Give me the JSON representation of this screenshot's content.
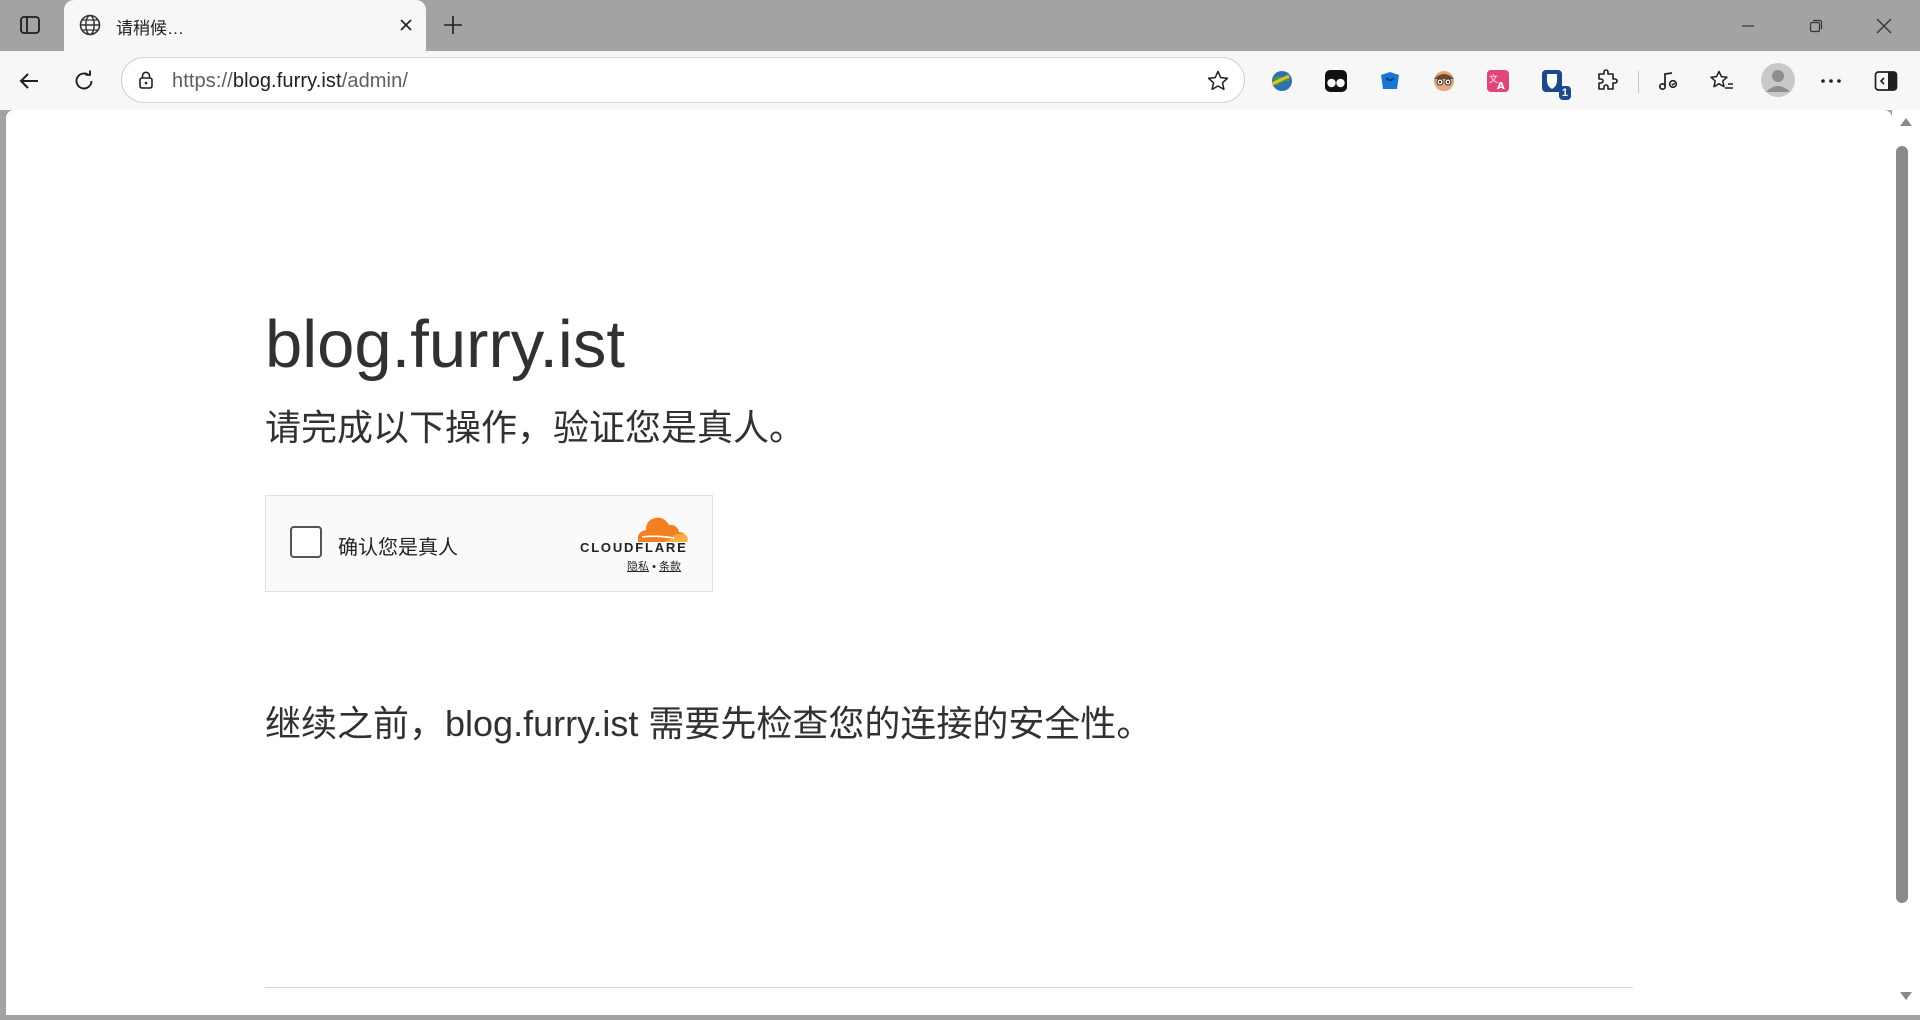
{
  "browser": {
    "tab": {
      "title": "请稍候…"
    },
    "address_bar": {
      "scheme": "https://",
      "host": "blog.furry.ist",
      "path": "/admin/"
    },
    "extensions": [
      {
        "name": "globe-extension-icon"
      },
      {
        "name": "tampermonkey-icon"
      },
      {
        "name": "blue-box-extension-icon"
      },
      {
        "name": "face-extension-icon"
      },
      {
        "name": "translate-extension-icon"
      },
      {
        "name": "bitwarden-icon",
        "badge": "1"
      },
      {
        "name": "extensions-icon"
      }
    ],
    "accent_color": "#1a4a8c"
  },
  "page": {
    "site_name": "blog.furry.ist",
    "lead": "请完成以下操作，验证您是真人。",
    "challenge": {
      "checkbox_label": "确认您是真人",
      "provider": "CLOUDFLARE",
      "privacy_link": "隐私",
      "separator": "•",
      "terms_link": "条款",
      "brand_color": "#f38020"
    },
    "footer_note": "继续之前，blog.furry.ist 需要先检查您的连接的安全性。"
  }
}
